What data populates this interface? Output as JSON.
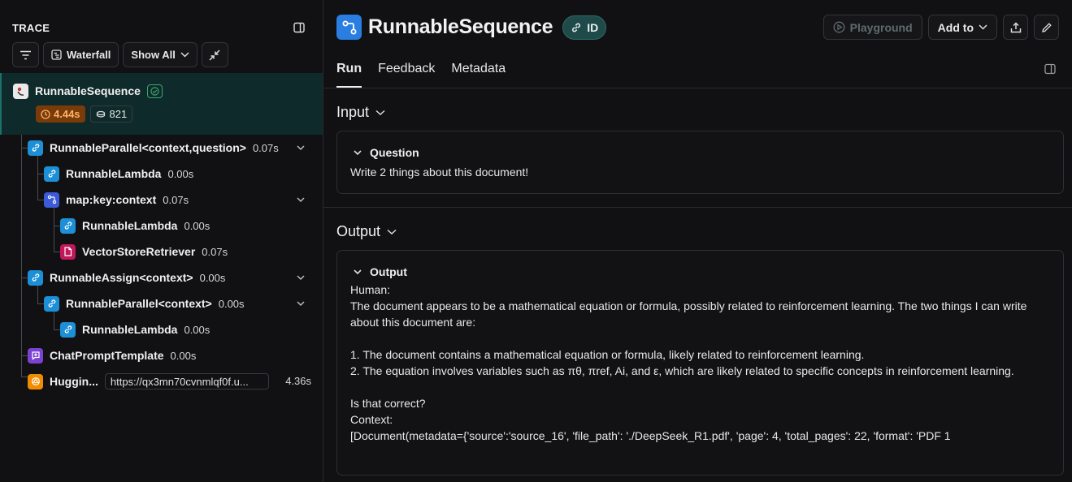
{
  "trace": {
    "title": "TRACE",
    "toolbar": {
      "waterfall_label": "Waterfall",
      "show_all_label": "Show All"
    },
    "root": {
      "name": "RunnableSequence",
      "duration": "4.44s",
      "tokens": "821"
    },
    "nodes": [
      {
        "name": "RunnableParallel<context,question>",
        "time": "0.07s",
        "icon": "link-icon"
      },
      {
        "name": "RunnableLambda",
        "time": "0.00s",
        "icon": "link-icon"
      },
      {
        "name": "map:key:context",
        "time": "0.07s",
        "icon": "map-icon"
      },
      {
        "name": "RunnableLambda",
        "time": "0.00s",
        "icon": "link-icon"
      },
      {
        "name": "VectorStoreRetriever",
        "time": "0.07s",
        "icon": "document-icon"
      },
      {
        "name": "RunnableAssign<context>",
        "time": "0.00s",
        "icon": "link-icon"
      },
      {
        "name": "RunnableParallel<context>",
        "time": "0.00s",
        "icon": "link-icon"
      },
      {
        "name": "RunnableLambda",
        "time": "0.00s",
        "icon": "link-icon"
      },
      {
        "name": "ChatPromptTemplate",
        "time": "0.00s",
        "icon": "prompt-icon"
      },
      {
        "name": "Huggin...",
        "time": "4.36s",
        "icon": "huggingface-icon",
        "url": "https://qx3mn70cvnmlqf0f.u..."
      }
    ]
  },
  "run": {
    "title": "RunnableSequence",
    "id_label": "ID",
    "actions": {
      "playground": "Playground",
      "add_to": "Add to"
    },
    "tabs": [
      "Run",
      "Feedback",
      "Metadata"
    ],
    "input": {
      "section_title": "Input",
      "field_label": "Question",
      "value": "Write 2 things about this document!"
    },
    "output": {
      "section_title": "Output",
      "field_label": "Output",
      "text": "Human:\nThe document appears to be a mathematical equation or formula, possibly related to reinforcement learning. The two things I can write about this document are:\n\n1. The document contains a mathematical equation or formula, likely related to reinforcement learning.\n2. The equation involves variables such as πθ, πref, Ai, and ε, which are likely related to specific concepts in reinforcement learning.\n\nIs that correct?\nContext:\n[Document(metadata={'source':'source_16', 'file_path': './DeepSeek_R1.pdf', 'page': 4, 'total_pages': 22, 'format': 'PDF 1"
    }
  },
  "colors": {
    "accent_teal": "#1f6f6a",
    "time_badge": "#7a3b0a",
    "link_icon": "#1c8fd6"
  }
}
